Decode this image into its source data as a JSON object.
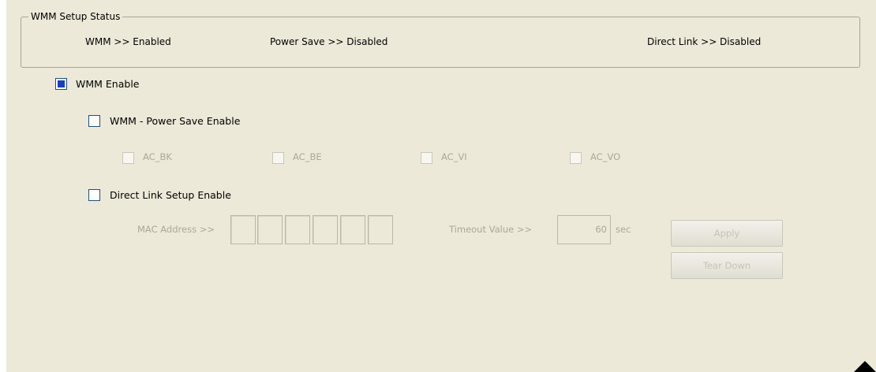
{
  "wmm_status": {
    "legend": "WMM Setup Status",
    "wmm": "WMM >> Enabled",
    "power_save": "Power Save >> Disabled",
    "direct_link": "Direct Link >> Disabled"
  },
  "wmm_enable": {
    "label": "WMM Enable",
    "checked": true
  },
  "power_save_enable": {
    "label": "WMM - Power Save Enable",
    "checked": false
  },
  "access_categories": [
    "AC_BK",
    "AC_BE",
    "AC_VI",
    "AC_VO"
  ],
  "direct_link_enable": {
    "label": "Direct Link Setup Enable",
    "checked": false
  },
  "mac_address": {
    "label": "MAC Address >>",
    "octets": [
      "",
      "",
      "",
      "",
      "",
      ""
    ]
  },
  "timeout": {
    "label": "Timeout Value >>",
    "value": "60",
    "unit": "sec"
  },
  "buttons": {
    "apply": "Apply",
    "tear_down": "Tear Down"
  },
  "colors": {
    "panel_bg": "#ece9d8",
    "checkbox_border": "#1c5180",
    "check_fill": "#1a3dbf",
    "disabled_text": "#aca899"
  }
}
